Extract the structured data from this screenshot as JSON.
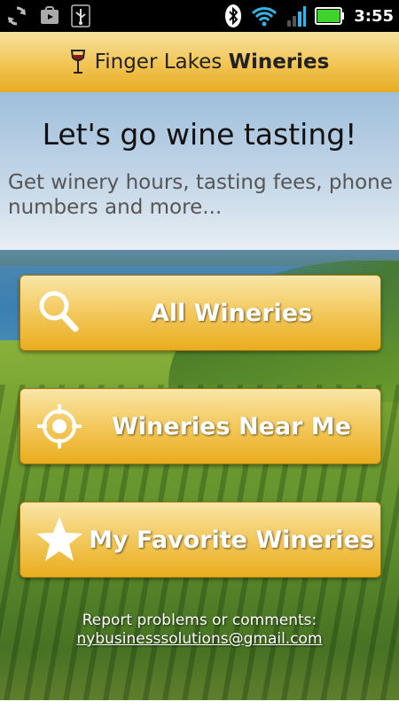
{
  "status_bar": {
    "time": "3:55",
    "icons": [
      "sync-icon",
      "store-icon",
      "usb-icon",
      "bluetooth-icon",
      "wifi-icon",
      "signal-icon",
      "battery-icon"
    ]
  },
  "header": {
    "title_regular": "Finger Lakes ",
    "title_bold": "Wineries",
    "logo_icon": "wine-glass-icon"
  },
  "main": {
    "headline": "Let's go wine tasting!",
    "subline": "Get winery hours, tasting fees, phone numbers and more..."
  },
  "buttons": [
    {
      "label": "All Wineries",
      "icon": "search-icon"
    },
    {
      "label": "Wineries Near Me",
      "icon": "crosshair-icon"
    },
    {
      "label": "My Favorite Wineries",
      "icon": "star-icon"
    }
  ],
  "footer": {
    "text": "Report problems or comments:",
    "email": "nybusinesssolutions@gmail.com"
  },
  "colors": {
    "accent": "#f2c453",
    "button_text": "#ffffff",
    "battery": "#3fd22c"
  }
}
